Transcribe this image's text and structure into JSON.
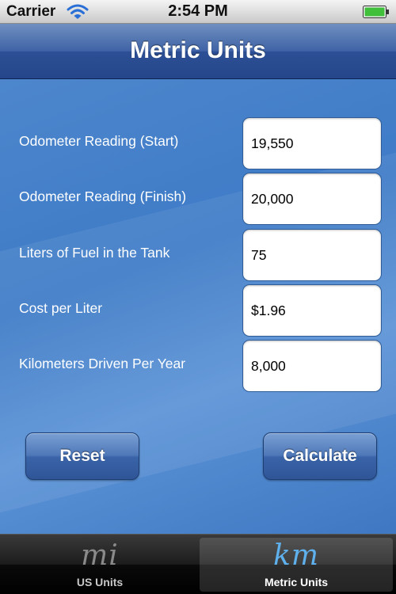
{
  "status_bar": {
    "carrier": "Carrier",
    "time": "2:54 PM",
    "signal_icon": "wifi-icon",
    "battery_icon": "battery-icon"
  },
  "nav": {
    "title": "Metric Units"
  },
  "fields": [
    {
      "label": "Odometer Reading (Start)",
      "value": "19,550"
    },
    {
      "label": "Odometer Reading (Finish)",
      "value": "20,000"
    },
    {
      "label": "Liters of Fuel in the Tank",
      "value": "75"
    },
    {
      "label": "Cost per Liter",
      "value": "$1.96"
    },
    {
      "label": "Kilometers Driven Per Year",
      "value": "8,000"
    }
  ],
  "buttons": {
    "reset": "Reset",
    "calculate": "Calculate"
  },
  "tabs": [
    {
      "glyph": "mi",
      "label": "US Units",
      "selected": false
    },
    {
      "glyph": "km",
      "label": "Metric Units",
      "selected": true
    }
  ],
  "colors": {
    "nav_bar": "#3f63a6",
    "content_background": "#4a84cb",
    "button": "#3a64a8",
    "selected_tab_glyph": "#5fb1ee"
  }
}
